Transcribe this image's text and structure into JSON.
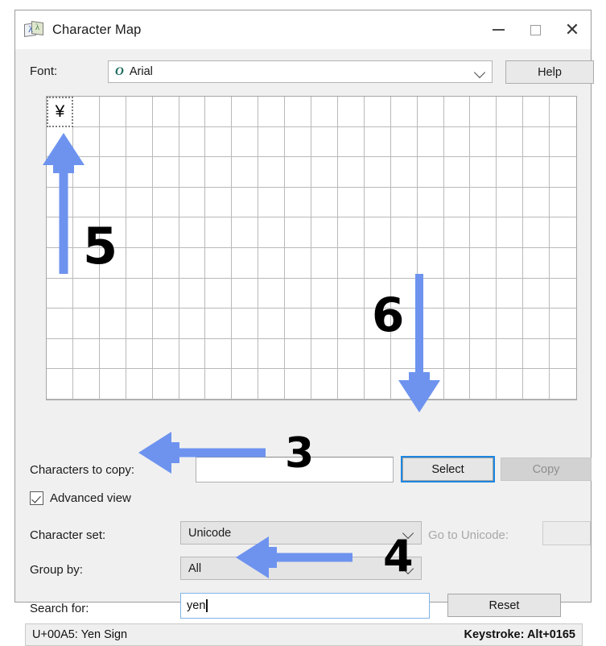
{
  "window": {
    "title": "Character Map",
    "icon": "character-map-icon",
    "controls": {
      "minimize": "minimize-icon",
      "maximize": "maximize-icon",
      "close": "close-icon"
    }
  },
  "font_row": {
    "label": "Font:",
    "ot_marker": "O",
    "value": "Arial",
    "help_label": "Help",
    "dropdown_icon": "chevron-down-icon"
  },
  "grid": {
    "columns": 20,
    "rows": 10,
    "selected_char": "¥",
    "selected_index": 0
  },
  "copy_row": {
    "label": "Characters to copy:",
    "value": "",
    "select_label": "Select",
    "copy_label": "Copy"
  },
  "advanced": {
    "label": "Advanced view",
    "checked": true,
    "check_icon": "checkmark-icon"
  },
  "charset_row": {
    "label": "Character set:",
    "value": "Unicode",
    "goto_label": "Go to Unicode:",
    "goto_value": ""
  },
  "group_row": {
    "label": "Group by:",
    "value": "All"
  },
  "search_row": {
    "label": "Search for:",
    "value": "yen",
    "reset_label": "Reset"
  },
  "status": {
    "left": "U+00A5: Yen Sign",
    "right": "Keystroke: Alt+0165"
  },
  "annotations": {
    "accent_color": "#6e93ef",
    "steps": [
      {
        "number": "3",
        "direction": "left",
        "target": "advanced-view-checkbox"
      },
      {
        "number": "4",
        "direction": "left",
        "target": "search-input"
      },
      {
        "number": "5",
        "direction": "up",
        "target": "character-grid-cell-selected"
      },
      {
        "number": "6",
        "direction": "down",
        "target": "select-button"
      }
    ]
  }
}
